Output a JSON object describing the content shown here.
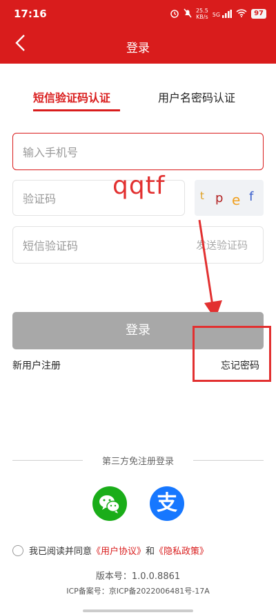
{
  "status_bar": {
    "time": "17:16",
    "network_speed": "25.5",
    "network_unit": "KB/s",
    "signal_label": "5G",
    "battery": "97"
  },
  "nav": {
    "back_icon": "chevron-left-icon",
    "title": "登录"
  },
  "tabs": [
    {
      "label": "短信验证码认证",
      "active": true
    },
    {
      "label": "用户名密码认证",
      "active": false
    }
  ],
  "form": {
    "phone_placeholder": "输入手机号",
    "captcha_placeholder": "验证码",
    "captcha_chars": [
      "t",
      "p",
      "e",
      "f"
    ],
    "sms_placeholder": "短信验证码",
    "send_code_label": "发送验证码",
    "login_label": "登录",
    "register_label": "新用户注册",
    "forgot_label": "忘记密码"
  },
  "annotation": {
    "text": "qqtf"
  },
  "third_party": {
    "title": "第三方免注册登录",
    "providers": [
      {
        "name": "wechat-icon",
        "color": "#1aad19"
      },
      {
        "name": "alipay-icon",
        "color": "#1677ff",
        "glyph": "支"
      }
    ]
  },
  "agreement": {
    "prefix": "我已阅读并同意",
    "user_agreement": "《用户协议》",
    "and": "和",
    "privacy_policy": "《隐私政策》"
  },
  "footer": {
    "version": "版本号：1.0.0.8861",
    "icp": "ICP备案号：京ICP备2022006481号-17A"
  },
  "colors": {
    "brand_red": "#d91c1c",
    "annotation_red": "#e23030",
    "button_disabled": "#a8a8a8"
  }
}
